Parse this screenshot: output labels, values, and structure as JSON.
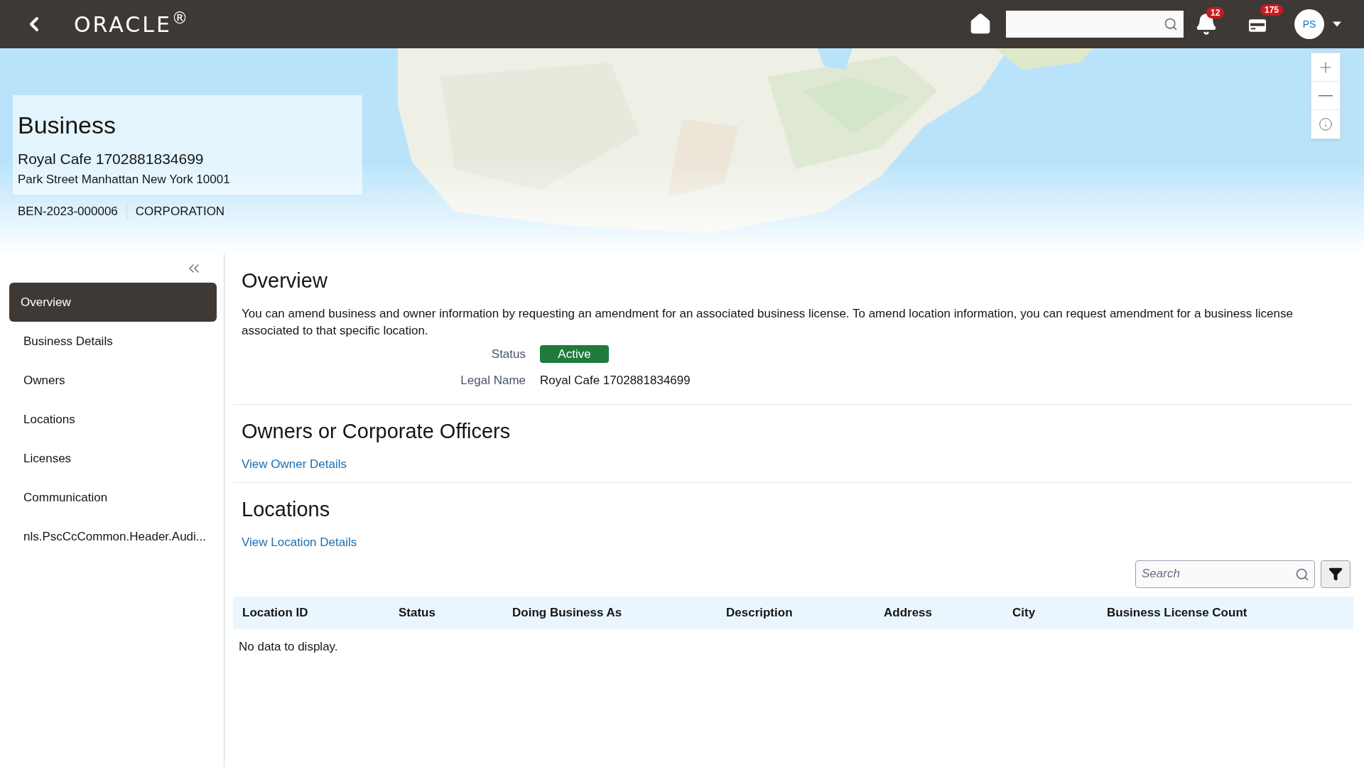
{
  "header": {
    "logo": "ORACLE$^{®}$",
    "notifications_badge": "12",
    "cart_badge": "175",
    "avatar": "PS"
  },
  "business": {
    "title": "Business",
    "name": "Royal Cafe 1702881834699",
    "address": "Park Street Manhattan New York 10001",
    "id": "BEN-2023-000006",
    "type": "CORPORATION"
  },
  "sidebar": {
    "items": [
      {
        "label": "Overview",
        "selected": true
      },
      {
        "label": "Business Details",
        "selected": false
      },
      {
        "label": "Owners",
        "selected": false
      },
      {
        "label": "Locations",
        "selected": false
      },
      {
        "label": "Licenses",
        "selected": false
      },
      {
        "label": "Communication",
        "selected": false
      },
      {
        "label": "nls.PscCcCommon.Header.Audi...",
        "selected": false
      }
    ]
  },
  "overview": {
    "title": "Overview",
    "description": "You can amend business and owner information by requesting an amendment for an associated business license. To amend location information, you can request amendment for a business license associated to that specific location.",
    "status_label": "Status",
    "status": "Active",
    "legal_name_label": "Legal Name",
    "legal_name": "Royal Cafe 1702881834699"
  },
  "owners": {
    "title": "Owners or Corporate Officers",
    "link": "View Owner Details"
  },
  "locations": {
    "title": "Locations",
    "link": "View Location Details",
    "search": {
      "placeholder": "Search"
    },
    "table": {
      "columns": [
        "Location ID",
        "Status",
        "Doing Business As",
        "Description",
        "Address",
        "City",
        "Business License Count"
      ],
      "empty": "No data to display."
    }
  }
}
